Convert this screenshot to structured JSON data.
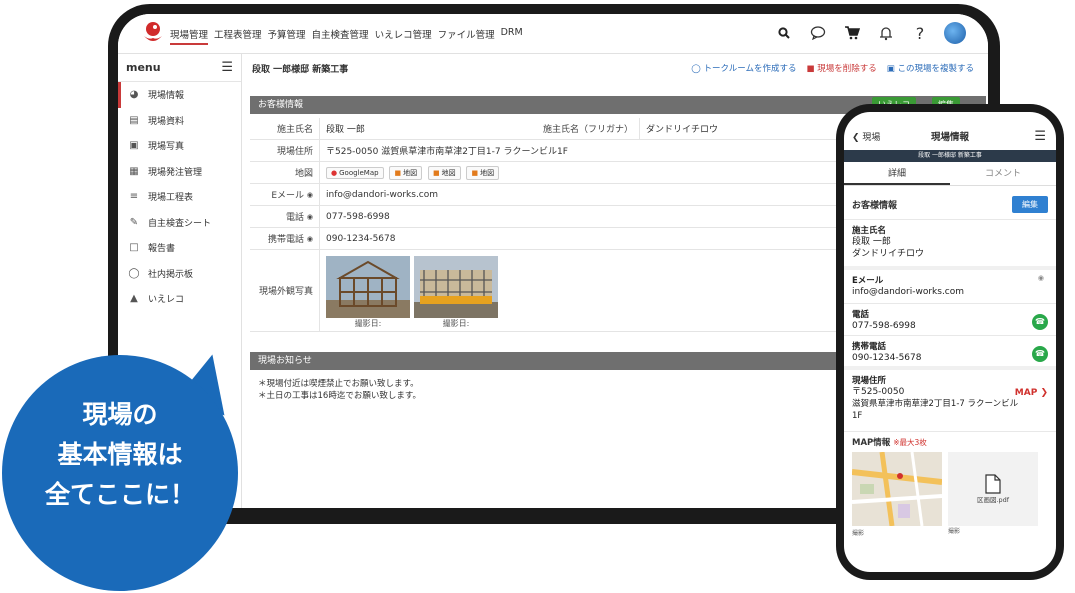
{
  "topnav": [
    "現場管理",
    "工程表管理",
    "予算管理",
    "自主検査管理",
    "いえレコ管理",
    "ファイル管理",
    "DRM"
  ],
  "sidebar": {
    "title": "menu",
    "items": [
      "現場情報",
      "現場資料",
      "現場写真",
      "現場発注管理",
      "現場工程表",
      "自主検査シート",
      "報告書",
      "社内掲示板",
      "いえレコ"
    ]
  },
  "page": {
    "title": "段取 一郎様邸 新築工事",
    "actions": [
      "トークルームを作成する",
      "現場を削除する",
      "この現場を複製する"
    ]
  },
  "customer": {
    "section": "お客様情報",
    "btn_ie": "いえレコ",
    "btn_edit": "編集",
    "name_label": "施主氏名",
    "name": "段取 一郎",
    "kana_label": "施主氏名（フリガナ）",
    "kana": "ダンドリイチロウ",
    "addr_label": "現場住所",
    "addr": "〒525-0050 滋賀県草津市南草津2丁目1-7 ラクーンビル1F",
    "map_label": "地図",
    "map_google": "GoogleMap",
    "map_doc": "地図",
    "email_label": "Eメール",
    "email": "info@dandori-works.com",
    "tel_label": "電話",
    "tel": "077-598-6998",
    "mobile_label": "携帯電話",
    "mobile": "090-1234-5678",
    "photo_label": "現場外観写真",
    "photo_caption": "撮影日:"
  },
  "notice": {
    "section": "現場お知らせ",
    "line1": "＊現場付近は喫煙禁止でお願い致します。",
    "line2": "＊土日の工事は16時迄でお願い致します。"
  },
  "phone": {
    "back": "現場",
    "title": "現場情報",
    "sub": "段取 一郎様邸 新築工事",
    "tab1": "詳細",
    "tab2": "コメント",
    "sec_title": "お客様情報",
    "edit": "編集",
    "name_label": "施主氏名",
    "name": "段取 一郎",
    "kana": "ダンドリイチロウ",
    "email_label": "Eメール",
    "email": "info@dandori-works.com",
    "tel_label": "電話",
    "tel": "077-598-6998",
    "mobile_label": "携帯電話",
    "mobile": "090-1234-5678",
    "addr_label": "現場住所",
    "zip": "〒525-0050",
    "addr": "滋賀県草津市南草津2丁目1-7 ラクーンビル1F",
    "map_link": "MAP",
    "mapinfo": "MAP情報",
    "mapinfo_note": "※最大3枚",
    "pdf_name": "区画図.pdf",
    "thumb_caption": "撮影"
  },
  "bubble": {
    "line1": "現場の",
    "line2": "基本情報は",
    "line3": "全てここに！"
  },
  "colors": {
    "brand_red": "#c93a3a",
    "accent_blue": "#1a6ab9",
    "green": "#3a9a35"
  }
}
